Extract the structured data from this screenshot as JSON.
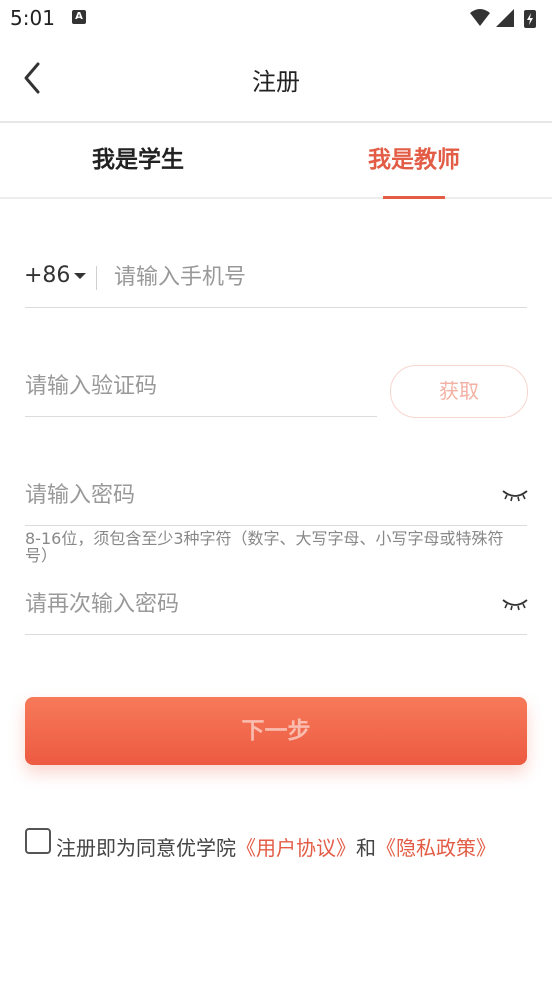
{
  "status_bar": {
    "time": "5:01",
    "notification_icon": "A"
  },
  "header": {
    "title": "注册",
    "back_icon": "chevron-left-icon"
  },
  "tabs": [
    {
      "label": "我是学生",
      "selected": false
    },
    {
      "label": "我是教师",
      "selected": true
    }
  ],
  "form": {
    "country_code": "+86",
    "phone_placeholder": "请输入手机号",
    "code_placeholder": "请输入验证码",
    "get_code_label": "获取",
    "password_placeholder": "请输入密码",
    "password_hint": "8-16位，须包含至少3种字符（数字、大写字母、小写字母或特殊符号）",
    "confirm_password_placeholder": "请再次输入密码",
    "next_label": "下一步"
  },
  "agreement": {
    "prefix": "注册即为同意优学院",
    "user_agreement": "《用户协议》",
    "and": "和",
    "privacy_policy": "《隐私政策》"
  },
  "colors": {
    "accent": "#e35d46",
    "button_start": "#f77a5a",
    "button_end": "#ec5a41"
  }
}
